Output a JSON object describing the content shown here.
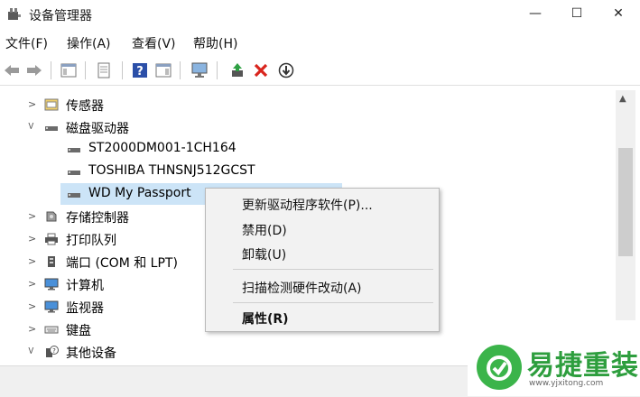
{
  "window": {
    "title": "设备管理器",
    "minimize_glyph": "—",
    "maximize_glyph": "☐",
    "close_glyph": "✕"
  },
  "menu": [
    "文件(F)",
    "操作(A)",
    "查看(V)",
    "帮助(H)"
  ],
  "toolbar": {
    "icons": [
      "back-arrow-icon",
      "forward-arrow-icon",
      "show-hide-console-tree-icon",
      "properties-icon",
      "help-icon",
      "action-pane-icon",
      "scan-hardware-icon",
      "update-driver-icon",
      "uninstall-icon",
      "disable-icon"
    ]
  },
  "tree": {
    "items": [
      {
        "label": "传感器",
        "expanded": false,
        "icon": "sensor-icon"
      },
      {
        "label": "磁盘驱动器",
        "expanded": true,
        "icon": "disk-drive-icon"
      },
      {
        "label": "ST2000DM001-1CH164",
        "icon": "drive-icon"
      },
      {
        "label": "TOSHIBA THNSNJ512GCST",
        "icon": "drive-icon"
      },
      {
        "label": "WD My Passport",
        "icon": "drive-icon",
        "selected": true
      },
      {
        "label": "存储控制器",
        "expanded": false,
        "icon": "storage-controller-icon"
      },
      {
        "label": "打印队列",
        "expanded": false,
        "icon": "printer-icon"
      },
      {
        "label": "端口 (COM 和 LPT)",
        "expanded": false,
        "icon": "port-icon"
      },
      {
        "label": "计算机",
        "expanded": false,
        "icon": "computer-icon"
      },
      {
        "label": "监视器",
        "expanded": false,
        "icon": "monitor-icon"
      },
      {
        "label": "键盘",
        "expanded": false,
        "icon": "keyboard-icon"
      },
      {
        "label": "其他设备",
        "expanded": true,
        "icon": "unknown-device-icon"
      }
    ]
  },
  "context_menu": {
    "items": [
      "更新驱动程序软件(P)...",
      "禁用(D)",
      "卸载(U)",
      "扫描检测硬件改动(A)",
      "属性(R)"
    ]
  },
  "logo": {
    "text": "易捷重装",
    "url": "www.yjxitong.com"
  },
  "colors": {
    "selection": "#cce4f7",
    "logo_green": "#3bb44a",
    "delete_red": "#d9251d"
  }
}
